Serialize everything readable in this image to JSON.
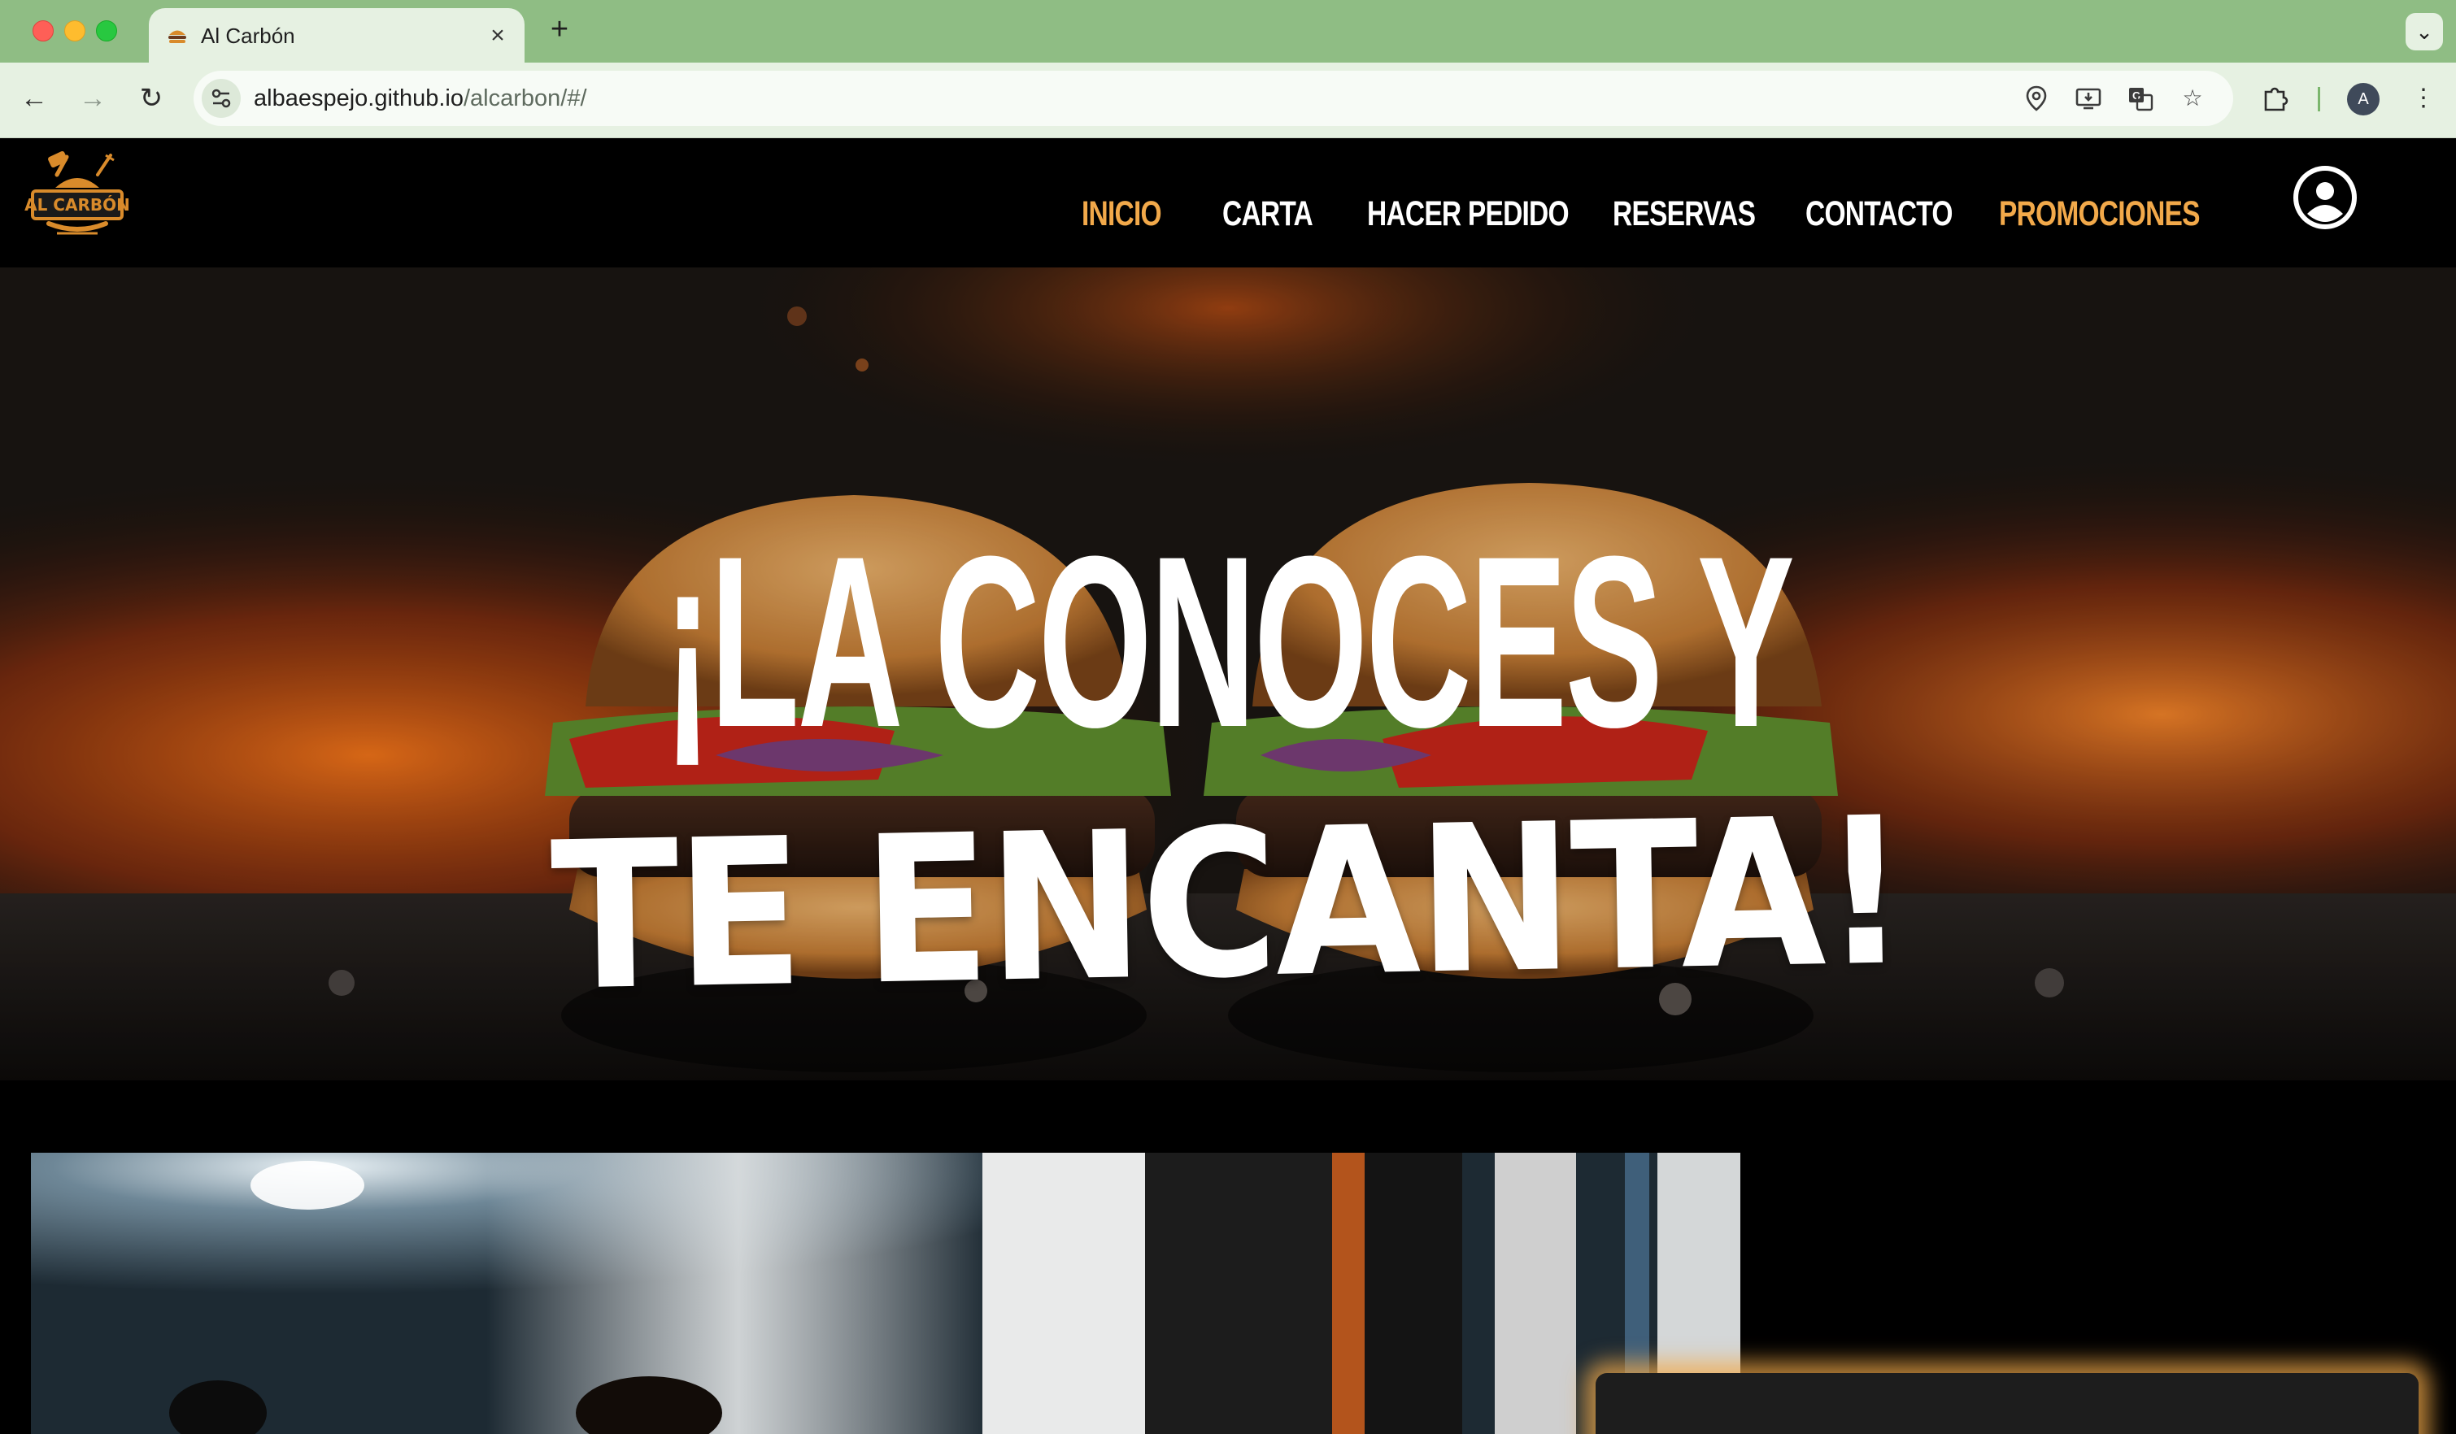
{
  "browser": {
    "tab": {
      "title": "Al Carbón",
      "favicon": "burger-favicon"
    },
    "url": {
      "host": "albaespejo.github.io",
      "path": "/alcarbon/#/"
    },
    "profile_initial": "A",
    "icons": {
      "back": "arrow-left-icon",
      "forward": "arrow-right-icon",
      "reload": "reload-icon",
      "new_tab": "plus-icon",
      "tab_close": "close-icon",
      "tab_search": "chevron-down-icon",
      "site_info": "tune-icon",
      "location": "location-pin-icon",
      "install": "install-app-icon",
      "translate": "translate-icon",
      "bookmark": "star-icon",
      "extensions": "puzzle-icon",
      "menu": "kebab-menu-icon"
    }
  },
  "site": {
    "brand": "AL CARBÓN",
    "nav": [
      {
        "label": "INICIO",
        "active": true
      },
      {
        "label": "CARTA"
      },
      {
        "label": "HACER PEDIDO"
      },
      {
        "label": "RESERVAS"
      },
      {
        "label": "CONTACTO"
      },
      {
        "label": "PROMOCIONES",
        "highlight": true
      }
    ],
    "user_icon": "user-circle-icon",
    "hero": {
      "line1": "¡LA CONOCES Y",
      "line2": "TE ENCANTA!"
    },
    "colors": {
      "accent": "#f2a94a",
      "background": "#000000",
      "text": "#ffffff"
    }
  }
}
